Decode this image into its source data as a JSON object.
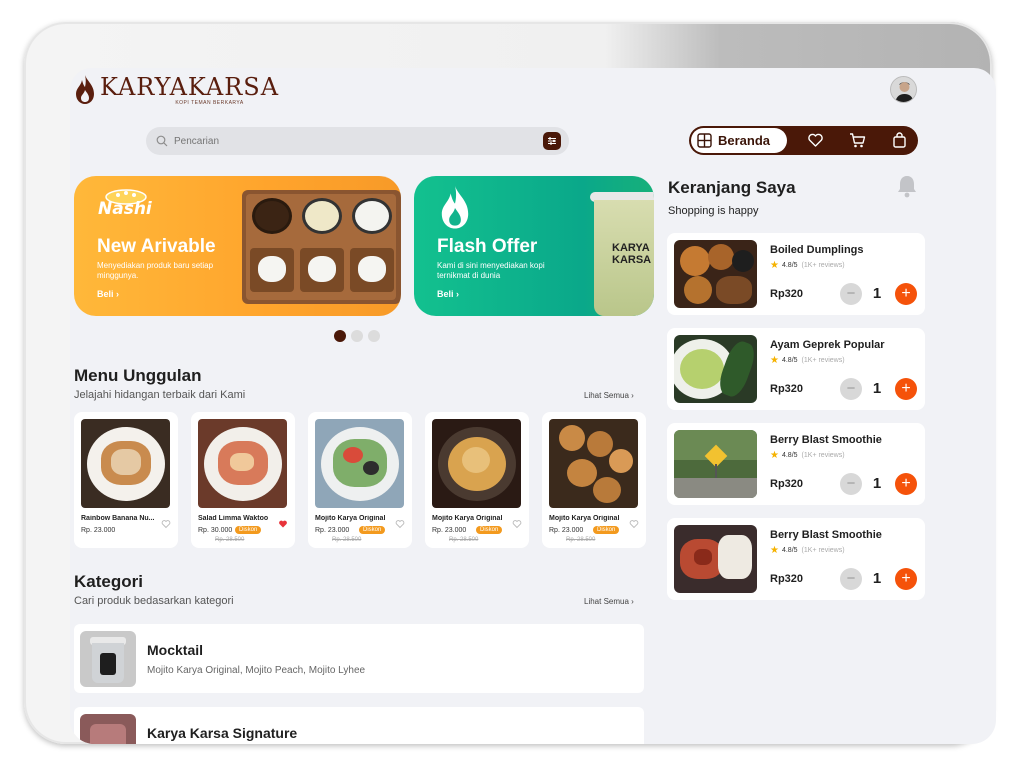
{
  "brand": {
    "name": "KARYAKARSA",
    "tagline": "KOPI TEMAN BERKARYA"
  },
  "search": {
    "placeholder": "Pencarian"
  },
  "nav": {
    "home_label": "Beranda",
    "icons": [
      "grid-icon",
      "heart-icon",
      "cart-icon",
      "bag-icon"
    ]
  },
  "banners": [
    {
      "logo_text": "Nashi",
      "title": "New Arivable",
      "desc": "Menyediakan produk baru setiap minggunya.",
      "cta": "Beli"
    },
    {
      "title": "Flash Offer",
      "desc": "Kami di sini menyediakan kopi ternikmat di dunia",
      "cta": "Beli",
      "cup_text": "KARYA KARSA"
    }
  ],
  "carousel": {
    "count": 3,
    "active": 0
  },
  "menu_unggulan": {
    "title": "Menu Unggulan",
    "subtitle": "Jelajahi hidangan terbaik dari Kami",
    "see_all": "Lihat Semua",
    "items": [
      {
        "name": "Rainbow Banana Nu...",
        "price": "Rp. 23.000",
        "old_price": "",
        "badge": "",
        "liked": false
      },
      {
        "name": "Salad Limma Waktoo",
        "price": "Rp. 30.000",
        "old_price": "Rp. 28.500",
        "badge": "Diskon",
        "liked": true
      },
      {
        "name": "Mojito Karya Original",
        "price": "Rp. 23.000",
        "old_price": "Rp. 28.500",
        "badge": "Diskon",
        "liked": false
      },
      {
        "name": "Mojito Karya Original",
        "price": "Rp. 23.000",
        "old_price": "Rp. 28.500",
        "badge": "Diskon",
        "liked": false
      },
      {
        "name": "Mojito Karya Original",
        "price": "Rp. 23.000",
        "old_price": "Rp. 28.500",
        "badge": "Diskon",
        "liked": false
      }
    ]
  },
  "kategori": {
    "title": "Kategori",
    "subtitle": "Cari produk bedasarkan kategori",
    "see_all": "Lihat Semua",
    "items": [
      {
        "name": "Mocktail",
        "items": "Mojito Karya Original, Mojito Peach, Mojito Lyhee"
      },
      {
        "name": "Karya Karsa Signature",
        "items": ""
      }
    ]
  },
  "cart": {
    "title": "Keranjang Saya",
    "subtitle": "Shopping is happy",
    "items": [
      {
        "name": "Boiled Dumplings",
        "rating": "4.8/5",
        "reviews": "(1K+ reviews)",
        "price": "Rp320",
        "qty": "1"
      },
      {
        "name": "Ayam Geprek Popular",
        "rating": "4.8/5",
        "reviews": "(1K+ reviews)",
        "price": "Rp320",
        "qty": "1"
      },
      {
        "name": "Berry Blast Smoothie",
        "rating": "4.8/5",
        "reviews": "(1K+ reviews)",
        "price": "Rp320",
        "qty": "1"
      },
      {
        "name": "Berry Blast Smoothie",
        "rating": "4.8/5",
        "reviews": "(1K+ reviews)",
        "price": "Rp320",
        "qty": "1"
      }
    ]
  },
  "colors": {
    "brand_brown": "#4a1808",
    "accent_orange": "#f5520a",
    "banner_orange": "#ffa42c",
    "banner_green": "#0aa88a",
    "discount_badge": "#f39a1e"
  }
}
